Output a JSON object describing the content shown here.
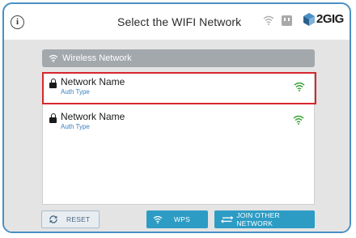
{
  "header": {
    "title": "Select the WIFI Network",
    "info_icon_glyph": "i",
    "brand_text": "2GIG",
    "status_icons": [
      "wifi-icon",
      "power-plug-icon"
    ]
  },
  "list": {
    "header_label": "Wireless Network",
    "networks": [
      {
        "name": "Network Name",
        "auth": "Auth Type",
        "selected": true,
        "secured": true
      },
      {
        "name": "Network Name",
        "auth": "Auth Type",
        "selected": false,
        "secured": true
      }
    ]
  },
  "footer": {
    "reset_label": "RESET",
    "wps_label": "WPS",
    "join_label": "JOIN OTHER NETWORK"
  },
  "colors": {
    "frame_border": "#4a8fc4",
    "selection_border": "#d7262f",
    "signal_green": "#3aa33a",
    "auth_blue": "#3a7fc0",
    "button_blue": "#2d9cc4",
    "header_bar_gray": "#a3a8ad"
  }
}
